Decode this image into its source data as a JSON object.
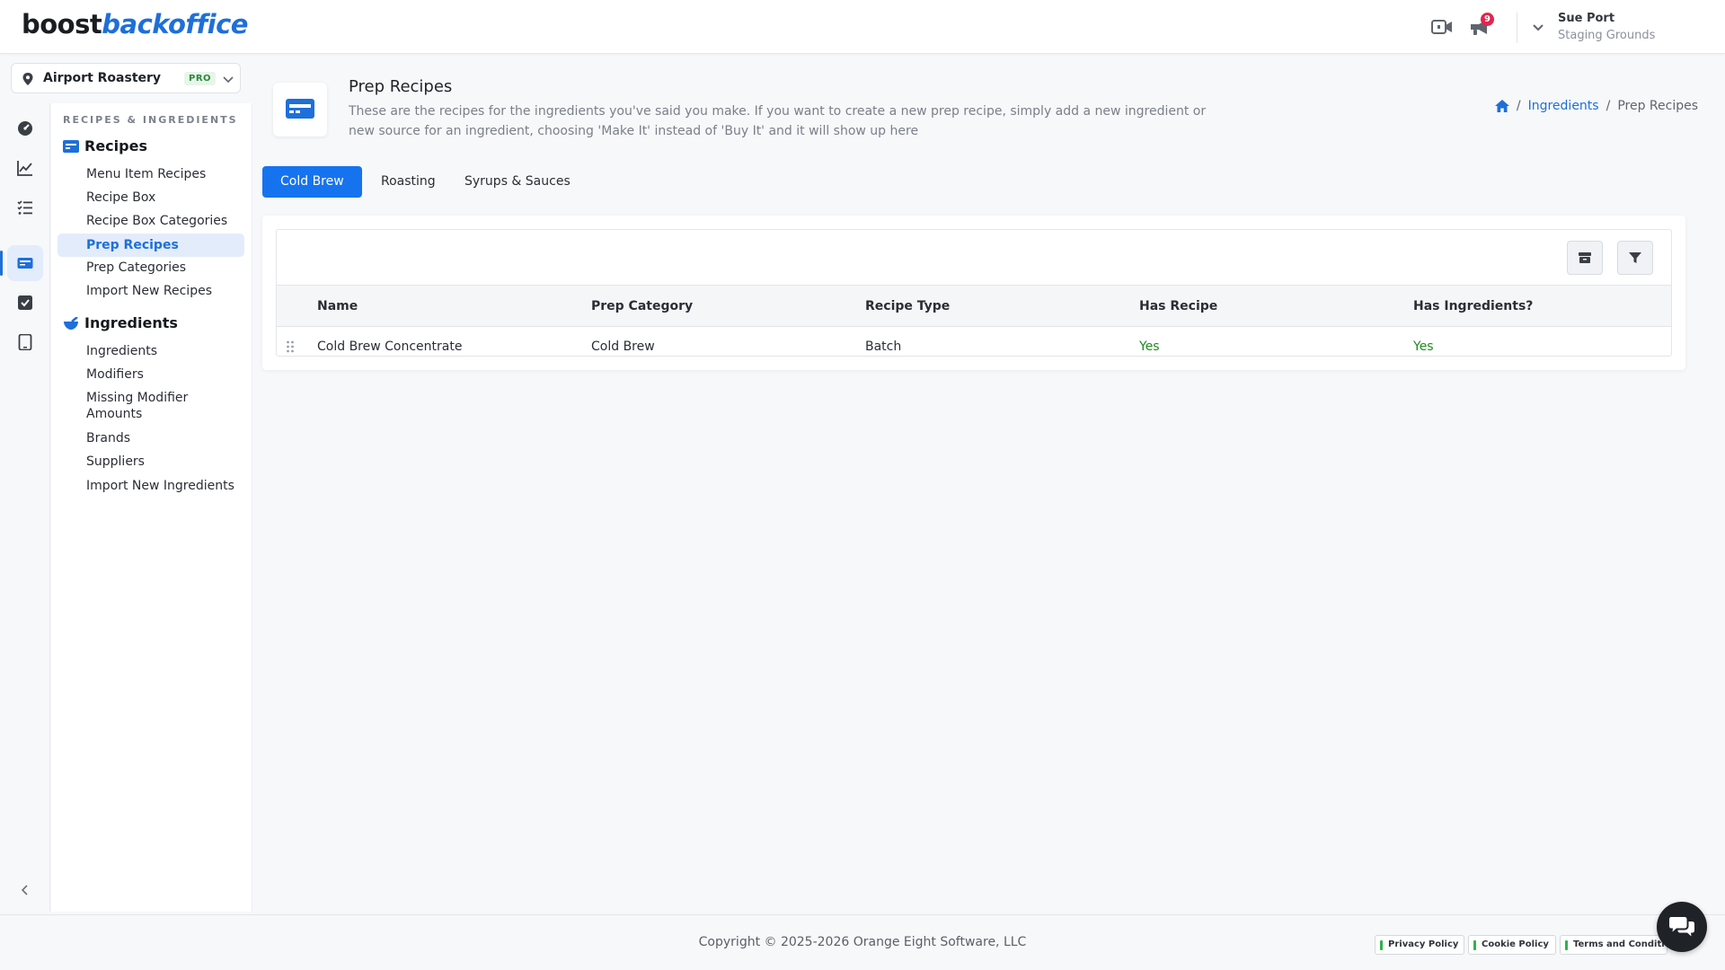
{
  "app": {
    "logo_part1": "boost",
    "logo_part2": "backoffice"
  },
  "header": {
    "notification_count": "9",
    "user_name": "Sue Port",
    "user_org": "Staging Grounds"
  },
  "location": {
    "name": "Airport Roastery",
    "tier": "PRO"
  },
  "sidenav": {
    "section_title": "RECIPES & INGREDIENTS",
    "recipes_heading": "Recipes",
    "recipes_items": [
      "Menu Item Recipes",
      "Recipe Box",
      "Recipe Box Categories",
      "Prep Recipes",
      "Prep Categories",
      "Import New Recipes"
    ],
    "ingredients_heading": "Ingredients",
    "ingredients_items": [
      "Ingredients",
      "Modifiers",
      "Missing Modifier Amounts",
      "Brands",
      "Suppliers",
      "Import New Ingredients"
    ]
  },
  "page": {
    "title": "Prep Recipes",
    "description": "These are the recipes for the ingredients you've said you make. If you want to create a new prep recipe, simply add a new ingredient or new source for an ingredient, choosing 'Make It' instead of 'Buy It' and it will show up here"
  },
  "breadcrumb": {
    "link": "Ingredients",
    "current": "Prep Recipes"
  },
  "tabs": [
    "Cold Brew",
    "Roasting",
    "Syrups & Sauces"
  ],
  "table": {
    "columns": [
      "Name",
      "Prep Category",
      "Recipe Type",
      "Has Recipe",
      "Has Ingredients?"
    ],
    "rows": [
      [
        "Cold Brew Concentrate",
        "Cold Brew",
        "Batch",
        "Yes",
        "Yes"
      ]
    ]
  },
  "footer": {
    "copyright": "Copyright © 2025-2026 Orange Eight Software, LLC",
    "privacy": "Privacy Policy",
    "cookie": "Cookie Policy",
    "terms": "Terms and Conditions"
  },
  "colors": {
    "accent": "#1673f0",
    "success": "#1f8a1f",
    "badge": "#e0264f"
  }
}
